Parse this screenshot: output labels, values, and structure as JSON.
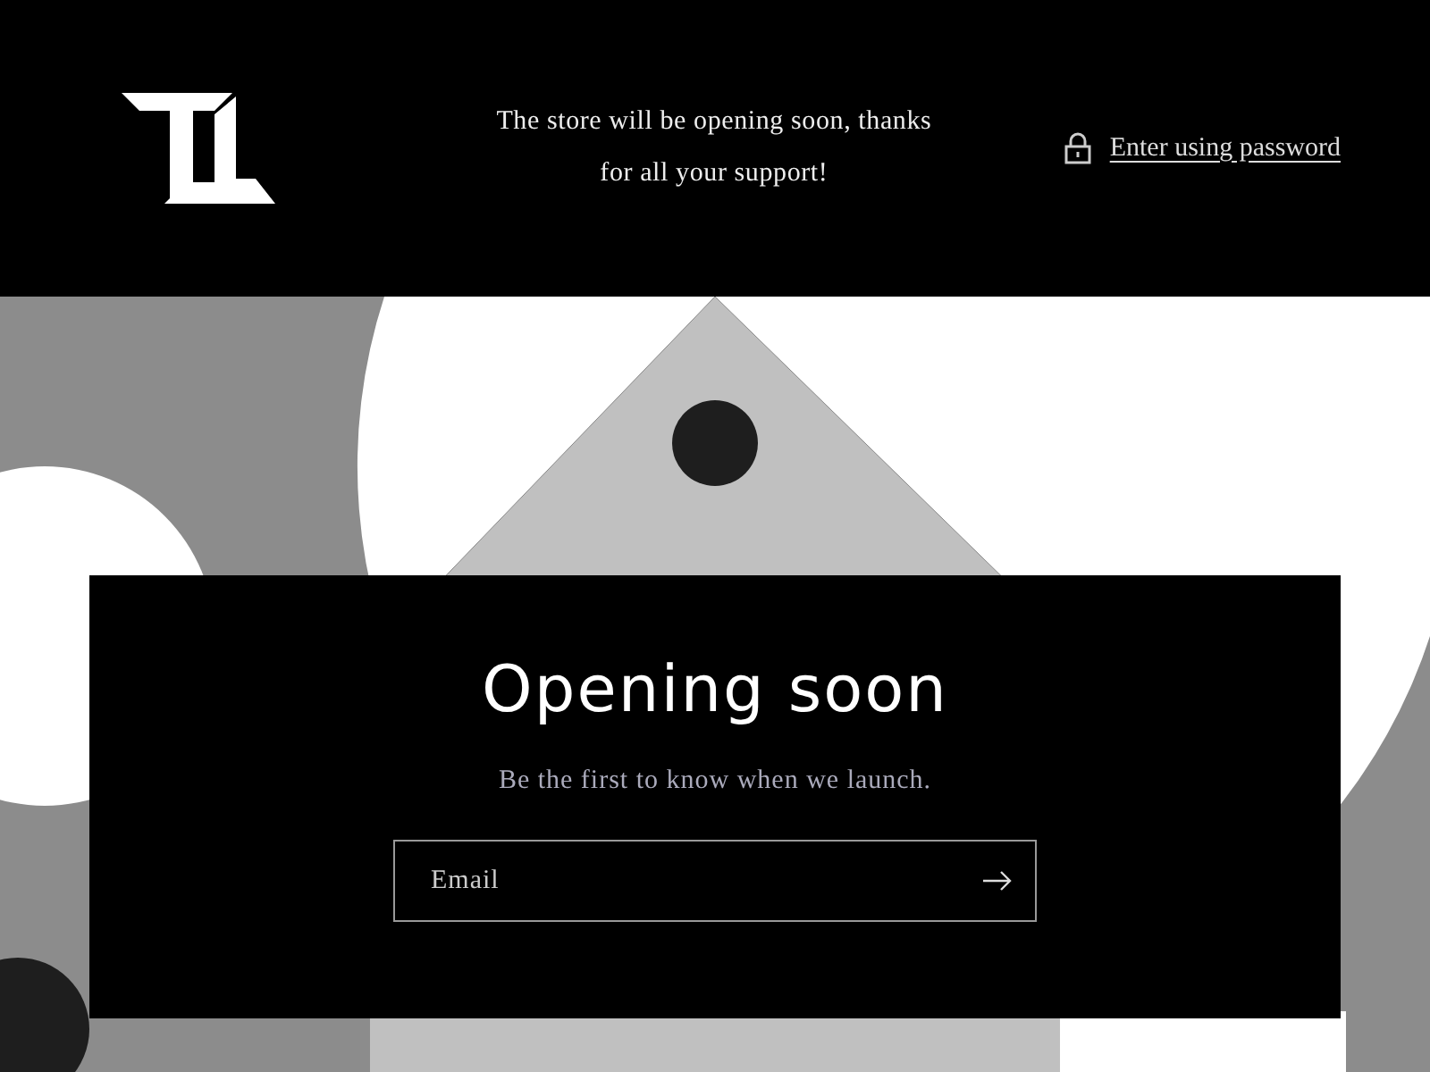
{
  "header": {
    "announcement": "The store will be opening soon, thanks for all your support!",
    "password_link": "Enter using password"
  },
  "hero": {
    "title": "Opening soon",
    "subtitle": "Be the first to know when we launch.",
    "email": {
      "placeholder": "Email"
    }
  }
}
